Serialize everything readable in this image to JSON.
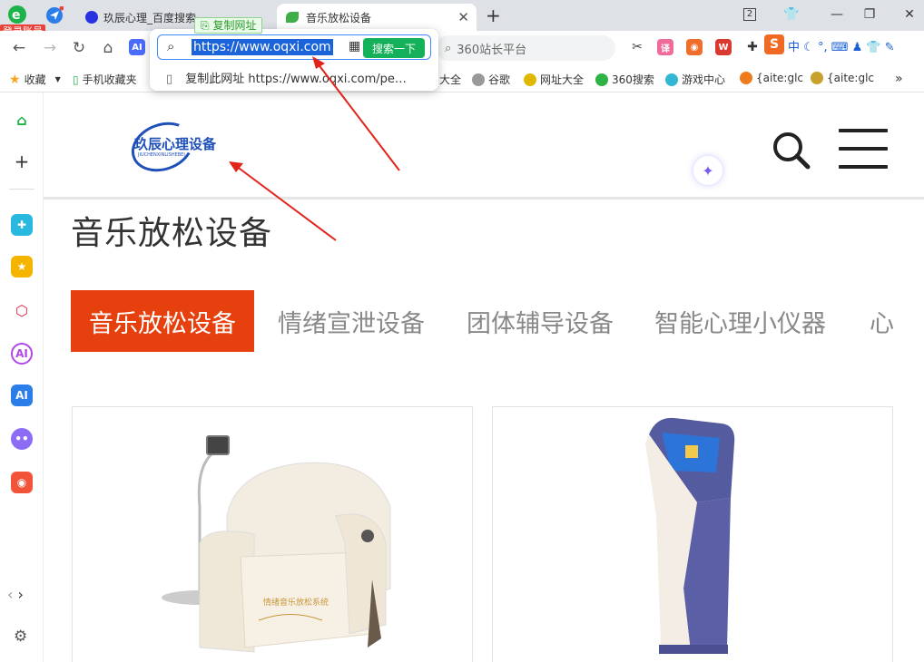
{
  "browser": {
    "tabs": [
      {
        "title": "玖辰心理_百度搜索"
      },
      {
        "title": "音乐放松设备"
      }
    ],
    "tab_count": "2",
    "login_label": "登录账号",
    "address": {
      "url_selected": "https://www.oqxi.com",
      "search_button": "搜索一下",
      "copy_tooltip": "复制网址",
      "suggestion": "复制此网址 https://www.oqxi.com/pe…"
    },
    "right_search_placeholder": "360站长平台",
    "ime_mode": "中",
    "bookmarks": [
      {
        "label": "收藏"
      },
      {
        "label": "手机收藏夹"
      },
      {
        "label": "大全"
      },
      {
        "label": "谷歌"
      },
      {
        "label": "网址大全"
      },
      {
        "label": "360搜索"
      },
      {
        "label": "游戏中心"
      },
      {
        "label": "{aite:glc"
      },
      {
        "label": "{aite:glc"
      }
    ],
    "more_bookmarks": "»"
  },
  "site": {
    "logo_text": "玖辰心理设备",
    "logo_sub": "JIUCHENXINLISHEBEI",
    "page_title": "音乐放松设备",
    "category_tabs": [
      {
        "label": "音乐放松设备"
      },
      {
        "label": "情绪宣泄设备"
      },
      {
        "label": "团体辅导设备"
      },
      {
        "label": "智能心理小仪器"
      },
      {
        "label": "心"
      }
    ],
    "chair_label": "情绪音乐放松系统"
  },
  "colors": {
    "accent": "#e5400e",
    "logo_blue": "#1f4fb8",
    "search_green": "#15b15a",
    "arrow_red": "#e2231a"
  }
}
